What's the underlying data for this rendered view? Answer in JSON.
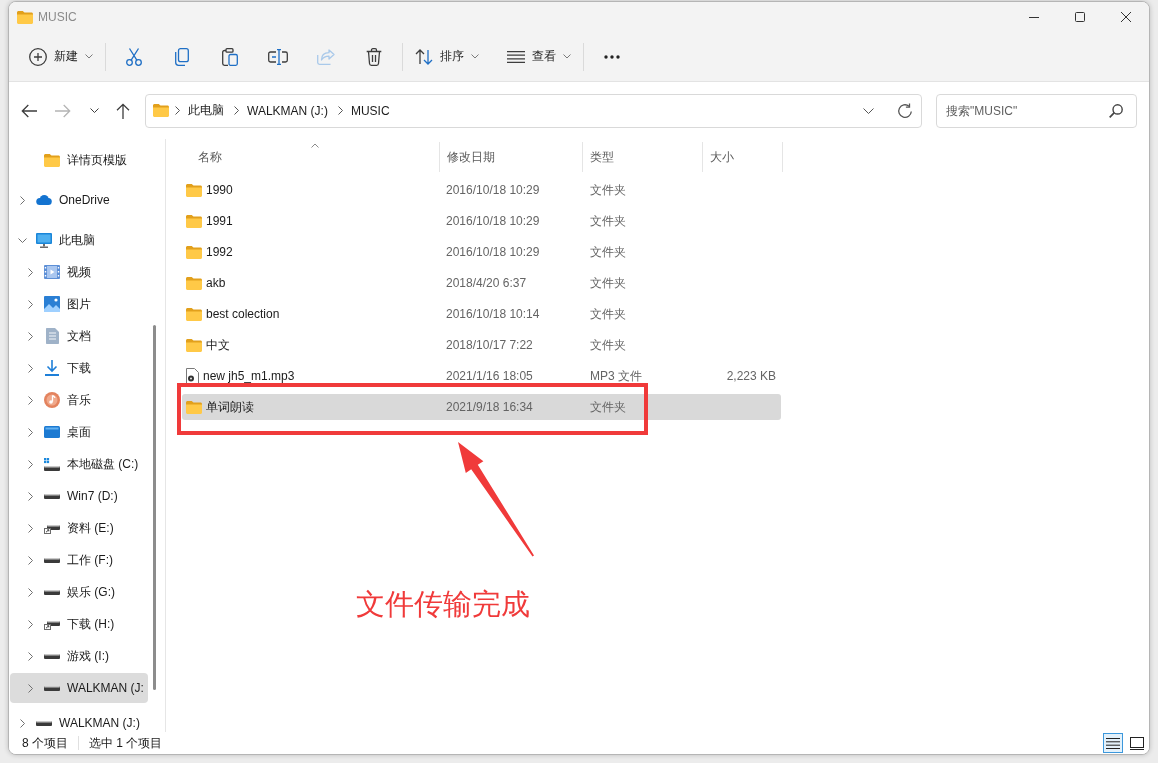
{
  "window": {
    "title": "MUSIC"
  },
  "toolbar": {
    "groups": [
      [
        {
          "kind": "new",
          "label": "新建",
          "disabled": false
        }
      ],
      [
        {
          "kind": "cut",
          "disabled": false
        },
        {
          "kind": "copy",
          "disabled": false
        },
        {
          "kind": "paste",
          "disabled": false
        },
        {
          "kind": "rename",
          "disabled": false
        },
        {
          "kind": "share",
          "disabled": true
        },
        {
          "kind": "delete",
          "disabled": false
        }
      ],
      [
        {
          "kind": "sort",
          "label": "排序",
          "disabled": false
        },
        {
          "kind": "view",
          "label": "查看",
          "disabled": false
        }
      ],
      [
        {
          "kind": "more",
          "disabled": false
        }
      ]
    ]
  },
  "navigation": [
    {
      "kind": "back",
      "disabled": false
    },
    {
      "kind": "forward",
      "disabled": true
    },
    {
      "kind": "recent",
      "disabled": false
    },
    {
      "kind": "up",
      "disabled": false
    }
  ],
  "address_bar": {
    "path": [
      "此电脑",
      "WALKMAN (J:)",
      "MUSIC"
    ]
  },
  "search": {
    "placeholder": "搜索\"MUSIC\""
  },
  "sidebar": {
    "items": [
      {
        "children": [
          {
            "kind": "folder",
            "label": "详情页模版",
            "selected": false
          }
        ]
      },
      {
        "kind": "cloud",
        "label": "OneDrive",
        "expanded": false,
        "selected": false
      },
      {
        "kind": "pc",
        "label": "此电脑",
        "expanded": true,
        "selected": false,
        "children": [
          {
            "kind": "video",
            "label": "视频",
            "expanded": false,
            "selected": false
          },
          {
            "kind": "pictures",
            "label": "图片",
            "expanded": false,
            "selected": false
          },
          {
            "kind": "documents",
            "label": "文档",
            "expanded": false,
            "selected": false
          },
          {
            "kind": "downloads",
            "label": "下载",
            "expanded": false,
            "selected": false
          },
          {
            "kind": "music",
            "label": "音乐",
            "expanded": false,
            "selected": false
          },
          {
            "kind": "desktop",
            "label": "桌面",
            "expanded": false,
            "selected": false
          },
          {
            "kind": "system-drive",
            "label": "本地磁盘 (C:)",
            "expanded": false,
            "selected": false
          },
          {
            "kind": "drive",
            "label": "Win7 (D:)",
            "expanded": false,
            "selected": false
          },
          {
            "kind": "network-drive",
            "label": "资料 (E:)",
            "expanded": false,
            "selected": false
          },
          {
            "kind": "drive",
            "label": "工作 (F:)",
            "expanded": false,
            "selected": false
          },
          {
            "kind": "drive",
            "label": "娱乐 (G:)",
            "expanded": false,
            "selected": false
          },
          {
            "kind": "network-drive",
            "label": "下载 (H:)",
            "expanded": false,
            "selected": false
          },
          {
            "kind": "drive",
            "label": "游戏 (I:)",
            "expanded": false,
            "selected": false
          },
          {
            "kind": "drive",
            "label": "WALKMAN (J:",
            "expanded": false,
            "selected": true
          }
        ]
      },
      {
        "kind": "drive",
        "label": "WALKMAN (J:)",
        "expanded": false,
        "selected": false
      }
    ]
  },
  "file_list": {
    "columns": [
      {
        "label": "名称",
        "sorted": true
      },
      {
        "label": "修改日期",
        "sorted": false
      },
      {
        "label": "类型",
        "sorted": false
      },
      {
        "label": "大小",
        "sorted": false
      }
    ],
    "rows": [
      {
        "kind": "folder",
        "name": "1990",
        "modified": "2016/10/18 10:29",
        "type": "文件夹",
        "selected": false
      },
      {
        "kind": "folder",
        "name": "1991",
        "modified": "2016/10/18 10:29",
        "type": "文件夹",
        "selected": false
      },
      {
        "kind": "folder",
        "name": "1992",
        "modified": "2016/10/18 10:29",
        "type": "文件夹",
        "selected": false
      },
      {
        "kind": "folder",
        "name": "akb",
        "modified": "2018/4/20 6:37",
        "type": "文件夹",
        "selected": false
      },
      {
        "kind": "folder",
        "name": "best colection",
        "modified": "2016/10/18 10:14",
        "type": "文件夹",
        "selected": false
      },
      {
        "kind": "folder",
        "name": "中文",
        "modified": "2018/10/17 7:22",
        "type": "文件夹",
        "selected": false
      },
      {
        "kind": "audio",
        "name": "new jh5_m1.mp3",
        "modified": "2021/1/16 18:05",
        "type": "MP3 文件",
        "size": "2,223 KB",
        "selected": false
      },
      {
        "kind": "folder",
        "name": "单词朗读",
        "modified": "2021/9/18 16:34",
        "type": "文件夹",
        "selected": true
      }
    ]
  },
  "annotation": {
    "caption": "文件传输完成"
  },
  "status_bar": {
    "item_count": "8 个项目",
    "selection": "选中 1 个项目",
    "view_modes": [
      {
        "kind": "details",
        "selected": true
      },
      {
        "kind": "pane",
        "selected": false
      }
    ]
  }
}
